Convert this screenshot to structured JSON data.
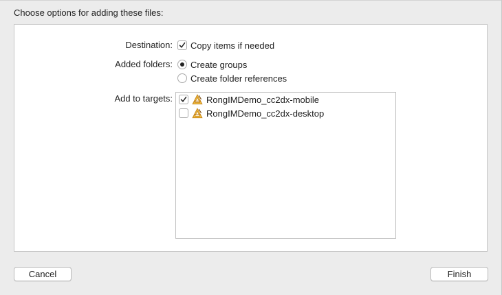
{
  "dialog": {
    "prompt": "Choose options for adding these files:"
  },
  "destination": {
    "label": "Destination:",
    "option_label": "Copy items if needed",
    "checked": true
  },
  "added_folders": {
    "label": "Added folders:",
    "options": [
      {
        "label": "Create groups",
        "selected": true
      },
      {
        "label": "Create folder references",
        "selected": false
      }
    ]
  },
  "targets": {
    "label": "Add to targets:",
    "items": [
      {
        "name": "RongIMDemo_cc2dx-mobile",
        "checked": true,
        "icon": "app-target-icon"
      },
      {
        "name": "RongIMDemo_cc2dx-desktop",
        "checked": false,
        "icon": "app-target-icon"
      }
    ]
  },
  "buttons": {
    "cancel": "Cancel",
    "finish": "Finish"
  }
}
